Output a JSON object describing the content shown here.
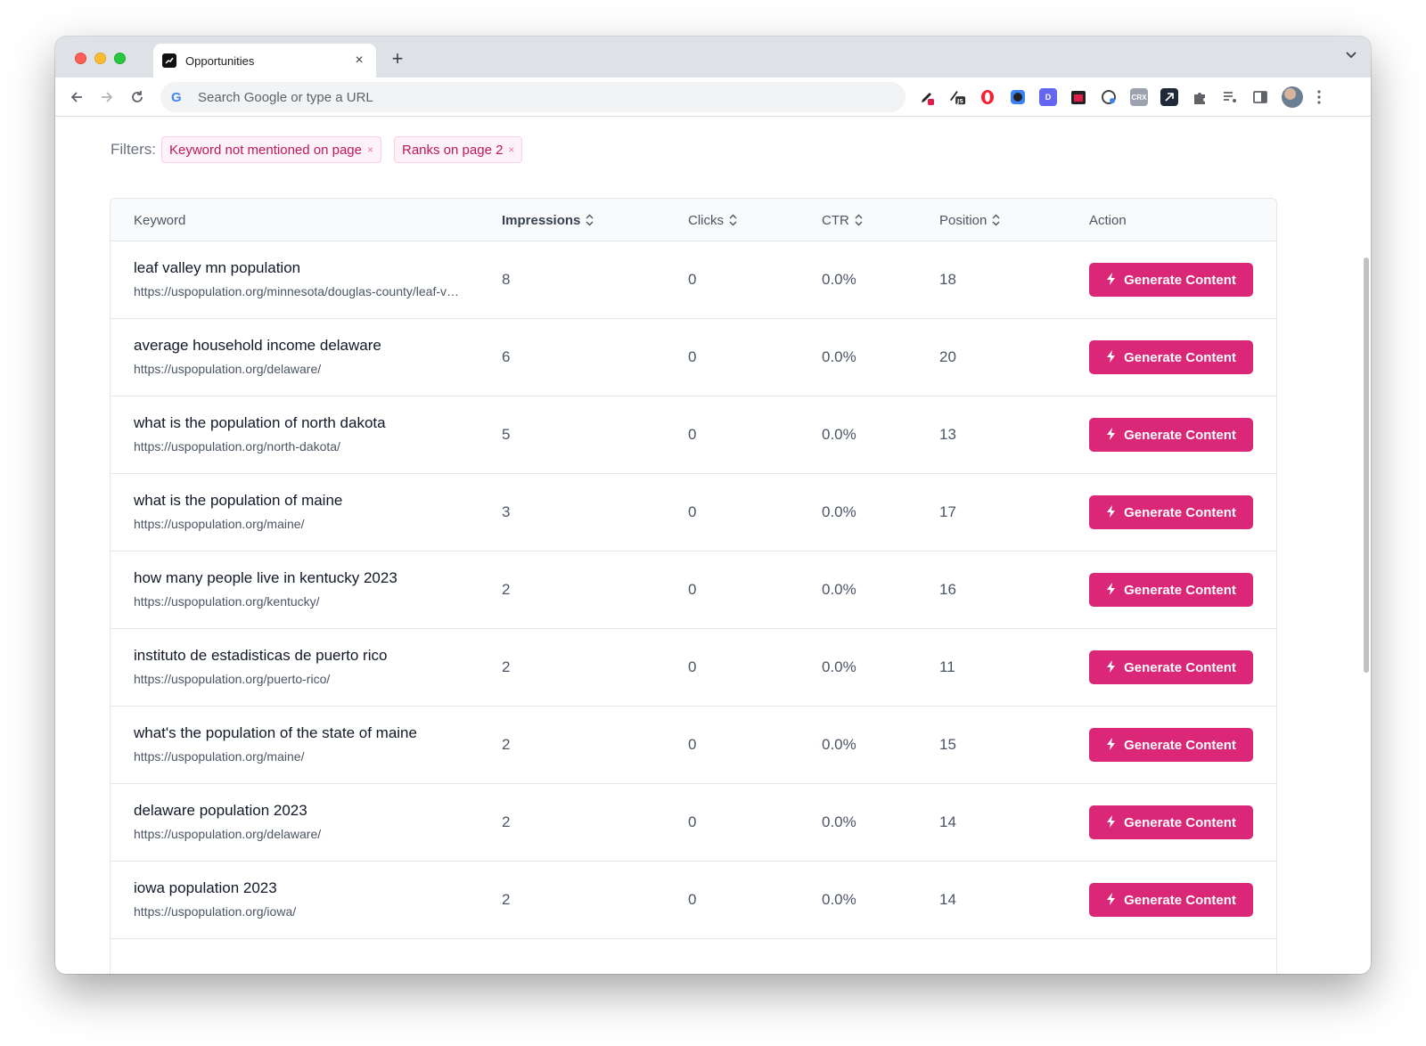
{
  "browser": {
    "tab_title": "Opportunities",
    "tab_close": "×",
    "new_tab": "+",
    "omnibox_placeholder": "Search Google or type a URL",
    "extensions": [
      "pen-icon",
      "js-icon",
      "opera-icon",
      "circle-icon",
      "d-icon",
      "calendar-icon",
      "globe-icon",
      "crx-icon",
      "arrow-icon",
      "puzzle-icon",
      "list-icon",
      "sidebar-icon"
    ],
    "ext_text": {
      "js": "JS",
      "crx": "CRX",
      "d": "D"
    }
  },
  "filters": {
    "label": "Filters:",
    "chips": [
      {
        "label": "Keyword not mentioned on page",
        "remove": "×"
      },
      {
        "label": "Ranks on page 2",
        "remove": "×"
      }
    ]
  },
  "table": {
    "headers": {
      "keyword": "Keyword",
      "impressions": "Impressions",
      "clicks": "Clicks",
      "ctr": "CTR",
      "position": "Position",
      "action": "Action"
    },
    "button_label": "Generate Content",
    "rows": [
      {
        "keyword": "leaf valley mn population",
        "url": "https://uspopulation.org/minnesota/douglas-county/leaf-valley/",
        "impressions": "8",
        "clicks": "0",
        "ctr": "0.0%",
        "position": "18"
      },
      {
        "keyword": "average household income delaware",
        "url": "https://uspopulation.org/delaware/",
        "impressions": "6",
        "clicks": "0",
        "ctr": "0.0%",
        "position": "20"
      },
      {
        "keyword": "what is the population of north dakota",
        "url": "https://uspopulation.org/north-dakota/",
        "impressions": "5",
        "clicks": "0",
        "ctr": "0.0%",
        "position": "13"
      },
      {
        "keyword": "what is the population of maine",
        "url": "https://uspopulation.org/maine/",
        "impressions": "3",
        "clicks": "0",
        "ctr": "0.0%",
        "position": "17"
      },
      {
        "keyword": "how many people live in kentucky 2023",
        "url": "https://uspopulation.org/kentucky/",
        "impressions": "2",
        "clicks": "0",
        "ctr": "0.0%",
        "position": "16"
      },
      {
        "keyword": "instituto de estadisticas de puerto rico",
        "url": "https://uspopulation.org/puerto-rico/",
        "impressions": "2",
        "clicks": "0",
        "ctr": "0.0%",
        "position": "11"
      },
      {
        "keyword": "what's the population of the state of maine",
        "url": "https://uspopulation.org/maine/",
        "impressions": "2",
        "clicks": "0",
        "ctr": "0.0%",
        "position": "15"
      },
      {
        "keyword": "delaware population 2023",
        "url": "https://uspopulation.org/delaware/",
        "impressions": "2",
        "clicks": "0",
        "ctr": "0.0%",
        "position": "14"
      },
      {
        "keyword": "iowa population 2023",
        "url": "https://uspopulation.org/iowa/",
        "impressions": "2",
        "clicks": "0",
        "ctr": "0.0%",
        "position": "14"
      }
    ]
  },
  "colors": {
    "accent": "#db2777",
    "chip_bg": "#fdf2f8",
    "chip_text": "#be185d"
  }
}
